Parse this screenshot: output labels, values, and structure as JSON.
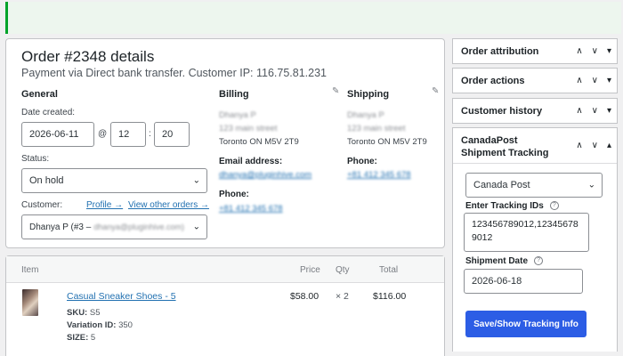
{
  "order": {
    "title": "Order #2348 details",
    "subtitle": "Payment via Direct bank transfer. Customer IP: 116.75.81.231",
    "general": {
      "heading": "General",
      "date_label": "Date created:",
      "date_value": "2026-06-11",
      "at_symbol": "@",
      "hour": "12",
      "colon": ":",
      "minute": "20",
      "status_label": "Status:",
      "status_value": "On hold",
      "customer_label": "Customer:",
      "profile_link": "Profile →",
      "other_orders_link": "View other orders →",
      "customer_value_prefix": "Dhanya P (#3 –",
      "customer_value_email": "dhanya@pluginhive.com)"
    },
    "billing": {
      "heading": "Billing",
      "name": "Dhanya P",
      "street": "123 main street",
      "city": "Toronto ON M5V 2T9",
      "email_label": "Email address:",
      "email_value": "dhanya@pluginhive.com",
      "phone_label": "Phone:",
      "phone_value": "+81 412 345 678"
    },
    "shipping": {
      "heading": "Shipping",
      "name": "Dhanya P",
      "street": "123 main street",
      "city": "Toronto ON M5V 2T9",
      "phone_label": "Phone:",
      "phone_value": "+81 412 345 678"
    }
  },
  "items": {
    "headers": {
      "item": "Item",
      "price": "Price",
      "qty": "Qty",
      "total": "Total"
    },
    "rows": [
      {
        "name": "Casual Sneaker Shoes - 5",
        "sku_label": "SKU:",
        "sku": "S5",
        "variation_label": "Variation ID:",
        "variation": "350",
        "size_label": "SIZE:",
        "size": "5",
        "price": "$58.00",
        "qty": "× 2",
        "total": "$116.00"
      }
    ]
  },
  "sidebar": {
    "attribution": "Order attribution",
    "actions": "Order actions",
    "history": "Customer history",
    "tracking": {
      "title_line1": "CanadaPost",
      "title_line2": "Shipment Tracking",
      "carrier": "Canada Post",
      "tracking_ids_label": "Enter Tracking IDs",
      "tracking_ids_value": "123456789012,123456789012",
      "shipment_date_label": "Shipment Date",
      "shipment_date_value": "2026-06-18",
      "button_label": "Save/Show Tracking Info"
    }
  },
  "icons": {
    "up": "∧",
    "down": "∨",
    "toggle_down": "▾",
    "toggle_up": "▴",
    "select": "⌄",
    "help": "?",
    "pencil": "✎"
  },
  "colors": {
    "accent": "#2271b1",
    "button": "#2c5de5",
    "notice_border": "#00a32a"
  }
}
